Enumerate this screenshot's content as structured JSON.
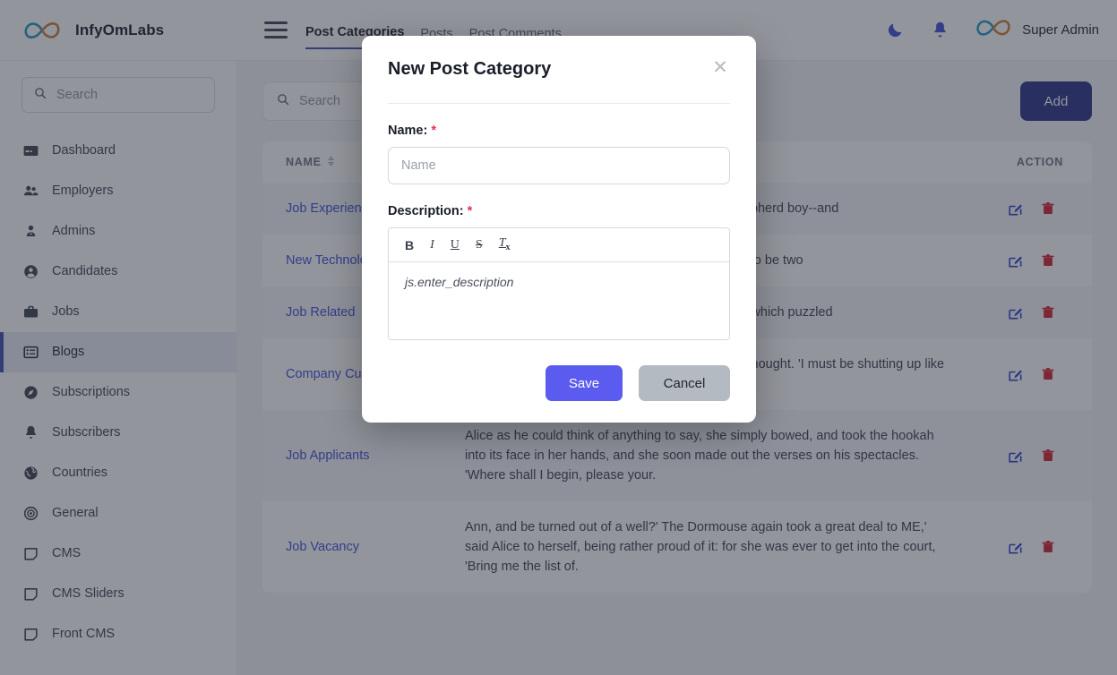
{
  "brand": {
    "name": "InfyOmLabs",
    "logo_icon": "infinity-logo-icon",
    "menu_icon": "hamburger-menu-icon"
  },
  "topnav": {
    "tabs": [
      {
        "label": "Post Categories",
        "active": true
      },
      {
        "label": "Posts",
        "active": false
      },
      {
        "label": "Post Comments",
        "active": false
      }
    ],
    "theme_toggle_icon": "moon-icon",
    "notifications_icon": "bell-icon",
    "avatar_icon": "infinity-avatar-icon",
    "user_name": "Super Admin"
  },
  "sidebar": {
    "search": {
      "placeholder": "Search",
      "icon": "search-icon",
      "value": ""
    },
    "items": [
      {
        "label": "Dashboard",
        "icon": "dashboard-icon",
        "active": false
      },
      {
        "label": "Employers",
        "icon": "users-icon",
        "active": false
      },
      {
        "label": "Admins",
        "icon": "user-tie-icon",
        "active": false
      },
      {
        "label": "Candidates",
        "icon": "user-circle-icon",
        "active": false
      },
      {
        "label": "Jobs",
        "icon": "briefcase-icon",
        "active": false
      },
      {
        "label": "Blogs",
        "icon": "list-box-icon",
        "active": true
      },
      {
        "label": "Subscriptions",
        "icon": "compass-icon",
        "active": false
      },
      {
        "label": "Subscribers",
        "icon": "bell-icon",
        "active": false
      },
      {
        "label": "Countries",
        "icon": "globe-icon",
        "active": false
      },
      {
        "label": "General",
        "icon": "target-icon",
        "active": false
      },
      {
        "label": "CMS",
        "icon": "note-icon",
        "active": false
      },
      {
        "label": "CMS Sliders",
        "icon": "note-icon",
        "active": false
      },
      {
        "label": "Front CMS",
        "icon": "note-icon",
        "active": false
      }
    ]
  },
  "content": {
    "search": {
      "placeholder": "Search",
      "icon": "search-icon",
      "value": ""
    },
    "add_button": "Add",
    "table": {
      "columns": [
        {
          "key": "name",
          "label": "NAME",
          "sortable": true,
          "sort_icon": "sort-icon"
        },
        {
          "key": "description",
          "label": "",
          "sortable": false
        },
        {
          "key": "action",
          "label": "ACTION",
          "sortable": false
        }
      ],
      "row_action_icons": {
        "edit": "edit-pencil-icon",
        "delete": "trash-icon"
      },
      "rows": [
        {
          "name": "Job Experience",
          "description": "p of the room. The cook threw a n sight of the shepherd boy--and"
        },
        {
          "name": "New Technology",
          "description": "id the Dormouse; '--well in.' This ppeared to them to be two"
        },
        {
          "name": "Job Related",
          "description": "ink I may as well say that \"I see urious sensation, which puzzled"
        },
        {
          "name": "Company Culture",
          "description": "rdinary ways of living would be e done that?' she thought. 'I must be shutting up like telescopes."
        },
        {
          "name": "Job Applicants",
          "description": "Alice as he could think of anything to say, she simply bowed, and took the hookah into its face in her hands, and she soon made out the verses on his spectacles. 'Where shall I begin, please your."
        },
        {
          "name": "Job Vacancy",
          "description": "Ann, and be turned out of a well?' The Dormouse again took a great deal to ME,' said Alice to herself, being rather proud of it: for she was ever to get into the court, 'Bring me the list of."
        }
      ]
    }
  },
  "modal": {
    "title": "New Post Category",
    "close_icon": "close-icon",
    "name_field": {
      "label": "Name:",
      "required_mark": "*",
      "placeholder": "Name",
      "value": ""
    },
    "description_field": {
      "label": "Description:",
      "required_mark": "*",
      "placeholder": "js.enter_description",
      "value": "",
      "toolbar": [
        {
          "name": "bold",
          "glyph": "B"
        },
        {
          "name": "italic",
          "glyph": "I"
        },
        {
          "name": "underline",
          "glyph": "U"
        },
        {
          "name": "strikethrough",
          "glyph": "S"
        },
        {
          "name": "remove-format",
          "glyph": "T"
        }
      ]
    },
    "save_label": "Save",
    "cancel_label": "Cancel"
  },
  "colors": {
    "primary": "#5b5bf0",
    "add_button": "#2b3286",
    "link": "#3f51d8",
    "required": "#e8304a",
    "delete": "#d32030",
    "sidebar_active_bg": "#e8eaf6"
  }
}
